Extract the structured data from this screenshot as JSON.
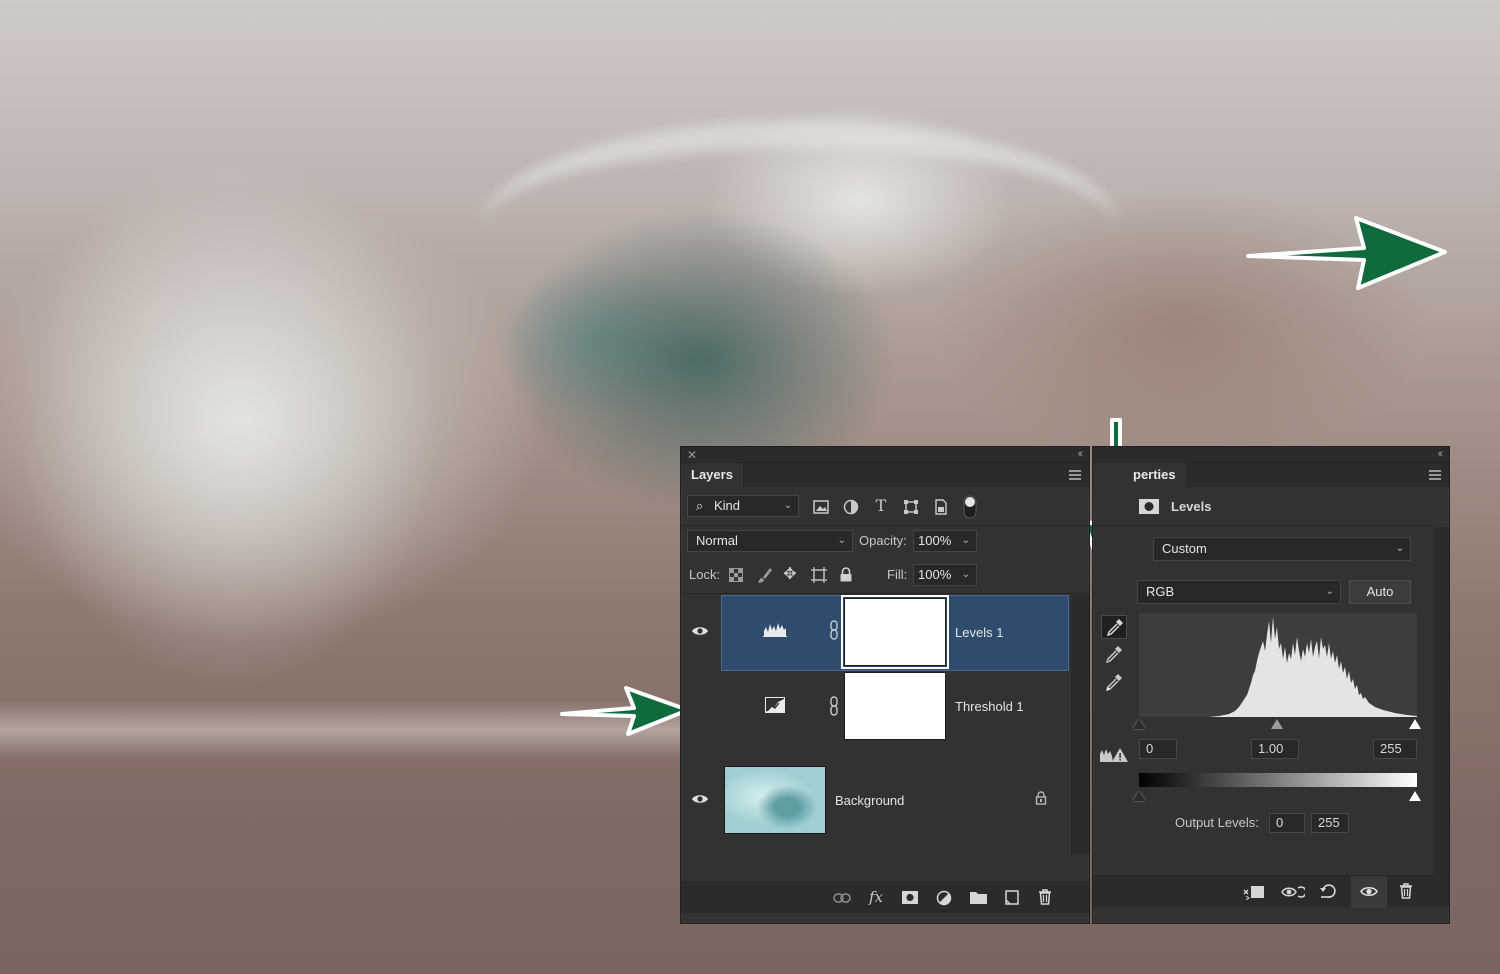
{
  "layers_panel": {
    "tab_label": "Layers",
    "filter_label": "Kind",
    "blend_mode": "Normal",
    "opacity_label": "Opacity:",
    "opacity_value": "100%",
    "lock_label": "Lock:",
    "fill_label": "Fill:",
    "fill_value": "100%",
    "layers": [
      {
        "name": "Levels 1",
        "visible": true,
        "selected": true
      },
      {
        "name": "Threshold 1",
        "visible": false,
        "selected": false
      },
      {
        "name": "Background",
        "visible": true,
        "locked": true
      }
    ],
    "footer_fx_label": "fx"
  },
  "properties_panel": {
    "tab_label": "perties",
    "adjustment_title": "Levels",
    "preset_value": "Custom",
    "channel_value": "RGB",
    "auto_label": "Auto",
    "input_black": "0",
    "input_gamma": "1.00",
    "input_white": "255",
    "output_label": "Output Levels:",
    "output_black": "0",
    "output_white": "255"
  },
  "colors": {
    "arrow": "#0f6b3b",
    "selection": "#2f4b6d",
    "panel_bg": "#323232"
  },
  "icons": [
    "close-icon",
    "collapse-icon",
    "panel-menu-icon",
    "search-icon",
    "eye-icon",
    "levels-icon",
    "threshold-icon",
    "chain-link-icon",
    "lock-icon",
    "eyedropper-icon",
    "warning-icon",
    "trash-icon",
    "visibility-icon",
    "reset-icon",
    "clip-icon",
    "folder-icon",
    "mask-icon",
    "adjustment-icon",
    "new-layer-icon",
    "fx-icon",
    "link-icon"
  ]
}
